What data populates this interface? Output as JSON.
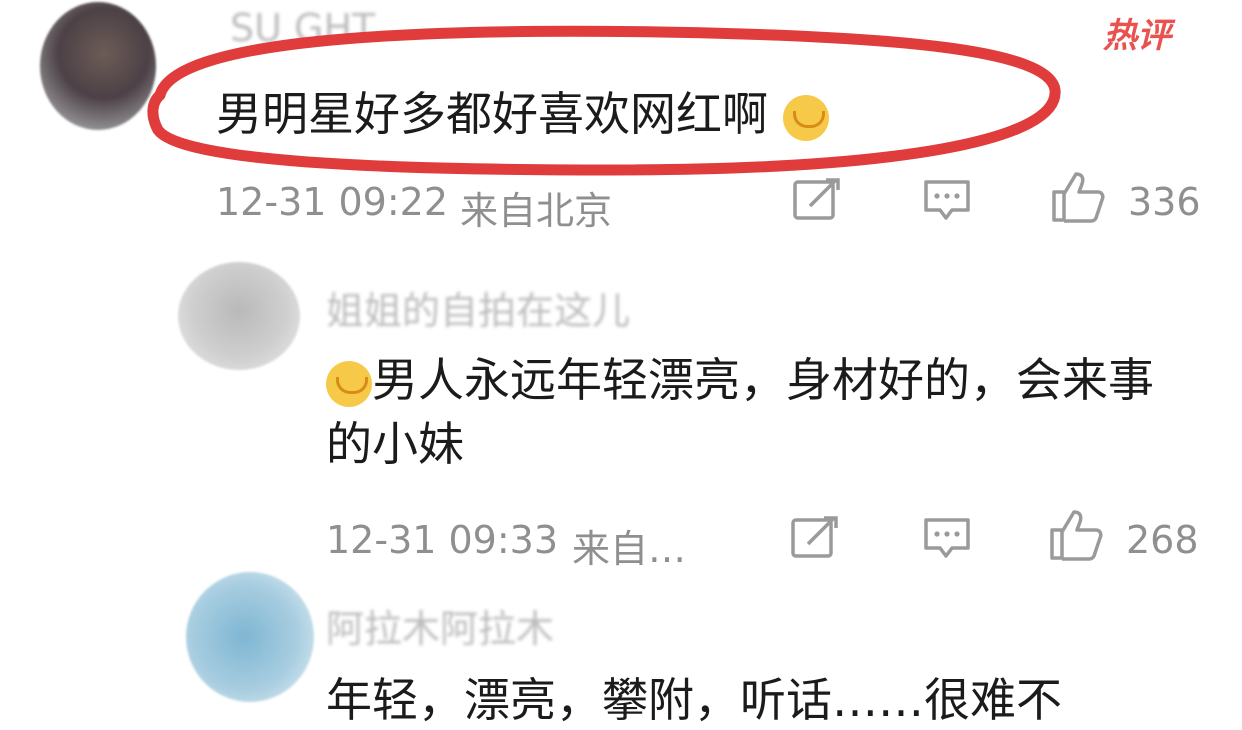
{
  "badge": {
    "hot_label": "热评"
  },
  "comments": [
    {
      "user_name": "SU  GHT",
      "text": "男明星好多都好喜欢网红啊",
      "timestamp": "12-31 09:22",
      "location": "来自北京",
      "likes": "336"
    },
    {
      "user_name": "姐姐的自拍在这儿",
      "text": "男人永远年轻漂亮，身材好的，会来事的小妹",
      "timestamp": "12-31 09:33",
      "location": "来自…",
      "likes": "268"
    },
    {
      "user_name": "阿拉木阿拉木",
      "text": "年轻，漂亮，攀附，听话……很难不",
      "timestamp": "",
      "location": "",
      "likes": ""
    }
  ],
  "icons": [
    "share-icon",
    "comment-icon",
    "like-icon"
  ],
  "colors": {
    "accent_red": "#e8534f",
    "meta_gray": "#8f8f8f",
    "text_black": "#1b1b1b"
  }
}
